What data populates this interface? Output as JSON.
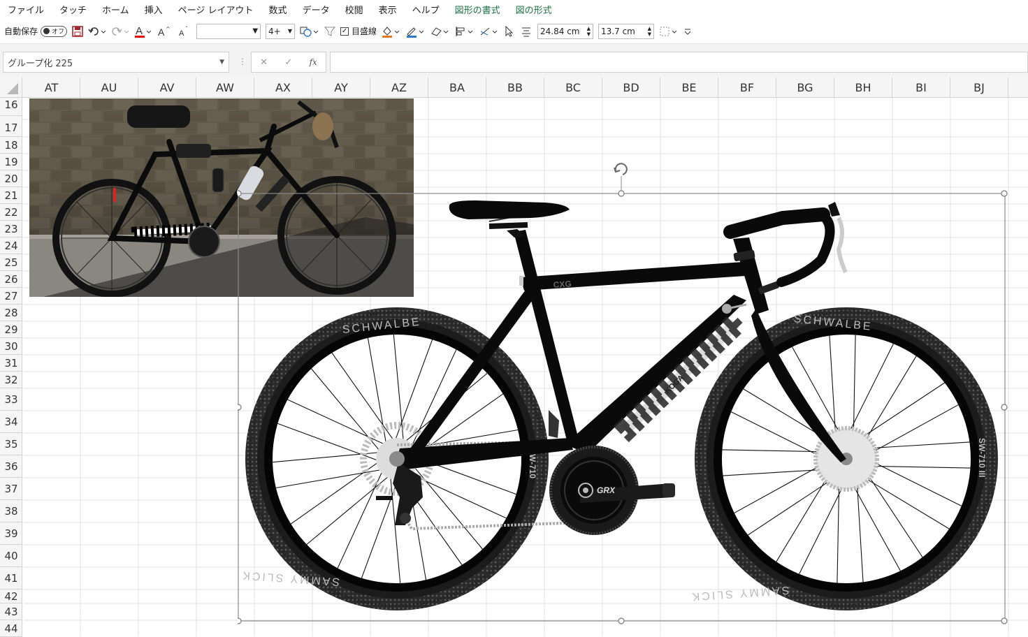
{
  "menu": [
    "ファイル",
    "タッチ",
    "ホーム",
    "挿入",
    "ページ レイアウト",
    "数式",
    "データ",
    "校閲",
    "表示",
    "ヘルプ",
    "図形の書式",
    "図の形式"
  ],
  "menu_green": [
    "図形の書式",
    "図の形式"
  ],
  "toolbar": {
    "autosave_label": "自動保存",
    "autosave_state": "オフ",
    "font_size": "4+",
    "gridlines_label": "目盛線",
    "height_value": "24.84 cm",
    "width_value": "13.7 cm"
  },
  "formula": {
    "name_box": "グループ化 225",
    "fx": "fx"
  },
  "columns": [
    "AT",
    "AU",
    "AV",
    "AW",
    "AX",
    "AY",
    "AZ",
    "BA",
    "BB",
    "BC",
    "BD",
    "BE",
    "BF",
    "BG",
    "BH",
    "BI",
    "BJ"
  ],
  "rows": [
    "16",
    "17",
    "18",
    "19",
    "20",
    "21",
    "22",
    "23",
    "24",
    "25",
    "26",
    "27",
    "28",
    "29",
    "30",
    "31",
    "32",
    "33",
    "34",
    "35",
    "36",
    "37",
    "38",
    "39",
    "40",
    "41",
    "42",
    "43",
    "44"
  ],
  "bike": {
    "frame_text": "CXG",
    "downtube_text": "KOGA",
    "crank_text": "GRX",
    "tire_brand_front": "SCHWALBE",
    "tire_brand_rear": "SCHWALBE",
    "tire_model_rear": "SW-710",
    "tire_model_front": "SW-710 III",
    "tire_sub_front": "SAMMY SLICK",
    "tire_sub_rear": "SAMMY SLICK"
  },
  "colors": {
    "green_tab": "#1e7145",
    "frame": "#0a0a0a",
    "tire": "#1c1c1c",
    "selection": "#8a8a8a"
  }
}
